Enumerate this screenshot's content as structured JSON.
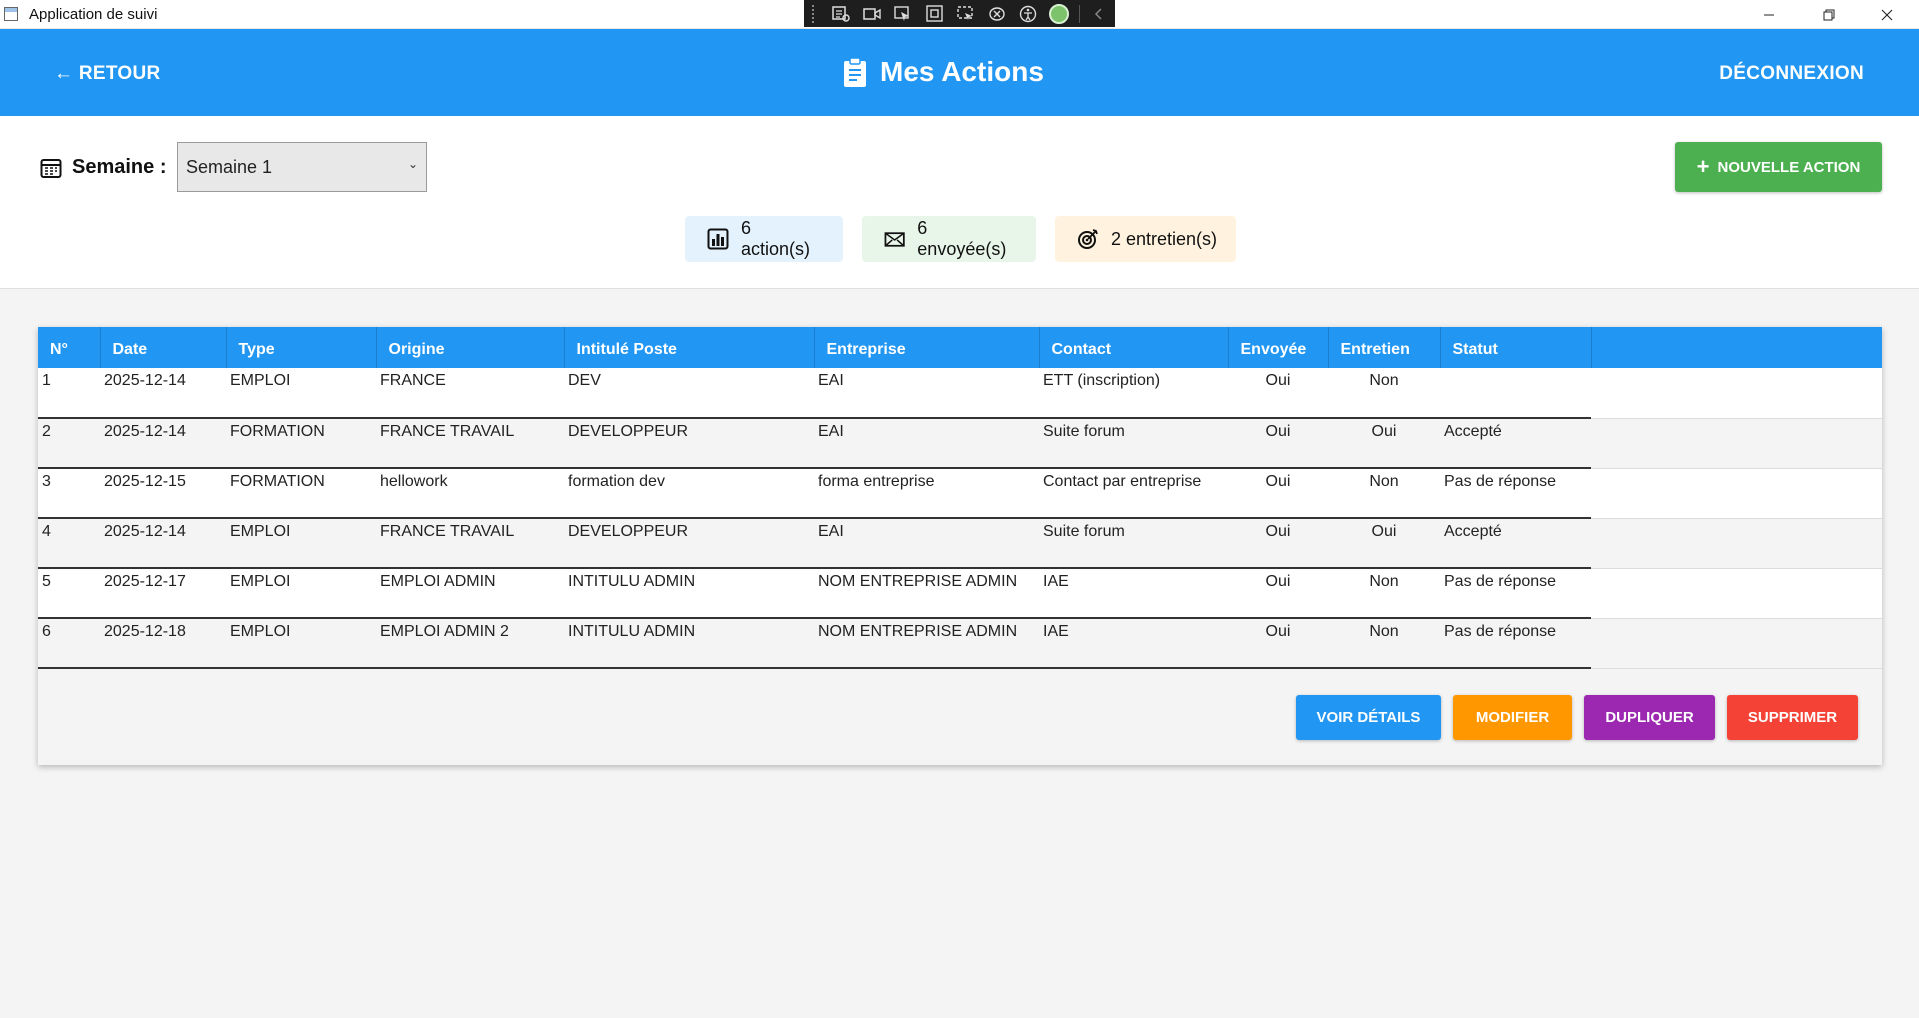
{
  "window": {
    "title": "Application de suivi",
    "icon": "app-window-icon"
  },
  "header": {
    "back_label": "← RETOUR",
    "title": "Mes Actions",
    "title_icon": "clipboard-icon",
    "logout_label": "DÉCONNEXION",
    "background": "#2196f3"
  },
  "filters": {
    "week_label": "Semaine :",
    "week_value": "Semaine 1",
    "new_action_label": "NOUVELLE ACTION"
  },
  "stats": {
    "actions": "6 action(s)",
    "sent": "6 envoyée(s)",
    "interviews": "2 entretien(s)"
  },
  "table": {
    "columns": [
      "N°",
      "Date",
      "Type",
      "Origine",
      "Intitulé Poste",
      "Entreprise",
      "Contact",
      "Envoyée",
      "Entretien",
      "Statut"
    ],
    "rows": [
      [
        "1",
        "2025-12-14",
        "EMPLOI",
        "FRANCE",
        "DEV",
        "EAI",
        "ETT (inscription)",
        "Oui",
        "Non",
        ""
      ],
      [
        "2",
        "2025-12-14",
        "FORMATION",
        "FRANCE TRAVAIL",
        "DEVELOPPEUR",
        "EAI",
        "Suite forum",
        "Oui",
        "Oui",
        "Accepté"
      ],
      [
        "3",
        "2025-12-15",
        "FORMATION",
        "hellowork",
        "formation dev",
        "forma entreprise",
        "Contact par entreprise",
        "Oui",
        "Non",
        "Pas de réponse"
      ],
      [
        "4",
        "2025-12-14",
        "EMPLOI",
        "FRANCE TRAVAIL",
        "DEVELOPPEUR",
        "EAI",
        "Suite forum",
        "Oui",
        "Oui",
        "Accepté"
      ],
      [
        "5",
        "2025-12-17",
        "EMPLOI",
        "EMPLOI ADMIN",
        "INTITULU ADMIN",
        "NOM ENTREPRISE ADMIN",
        "IAE",
        "Oui",
        "Non",
        "Pas de réponse"
      ],
      [
        "6",
        "2025-12-18",
        "EMPLOI",
        "EMPLOI ADMIN 2",
        "INTITULU ADMIN",
        "NOM ENTREPRISE ADMIN",
        "IAE",
        "Oui",
        "Non",
        "Pas de réponse"
      ]
    ]
  },
  "buttons": {
    "details": "VOIR DÉTAILS",
    "edit": "MODIFIER",
    "duplicate": "DUPLIQUER",
    "delete": "SUPPRIMER"
  },
  "colors": {
    "primary": "#2196f3",
    "success": "#4caf50",
    "warning": "#ff9800",
    "purple": "#9c27b0",
    "danger": "#f44336"
  }
}
